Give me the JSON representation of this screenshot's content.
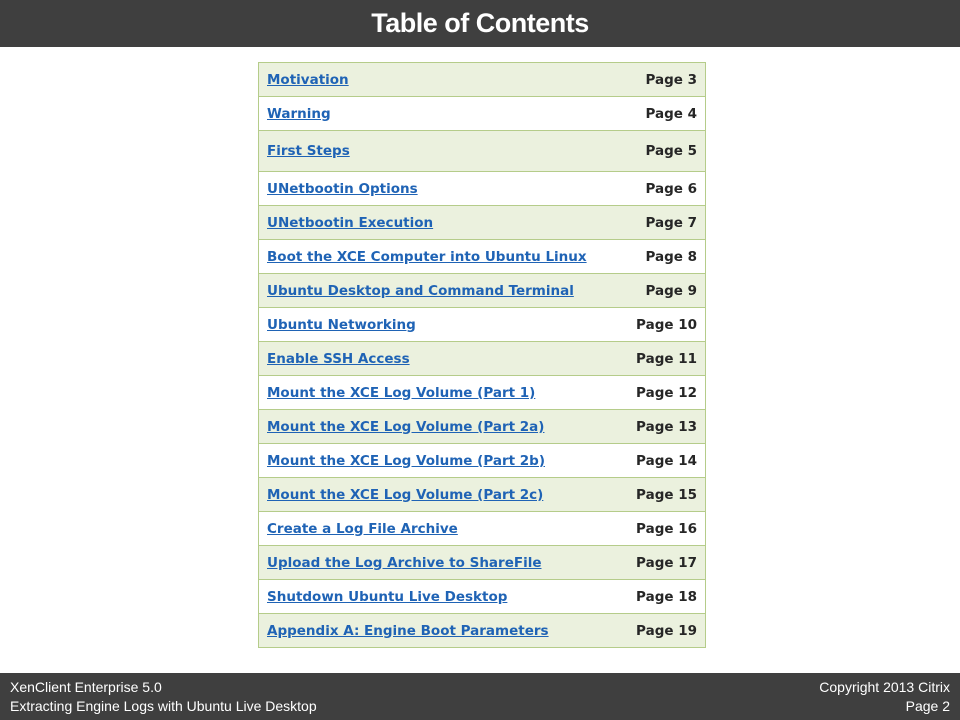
{
  "header": {
    "title": "Table of Contents"
  },
  "toc": [
    {
      "label": "Motivation",
      "page": "Page 3"
    },
    {
      "label": "Warning",
      "page": "Page 4"
    },
    {
      "label": "First Steps",
      "page": "Page 5"
    },
    {
      "label": "UNetbootin Options",
      "page": "Page 6"
    },
    {
      "label": "UNetbootin Execution",
      "page": "Page 7"
    },
    {
      "label": "Boot the XCE Computer into Ubuntu Linux",
      "page": "Page 8"
    },
    {
      "label": "Ubuntu Desktop and Command Terminal",
      "page": "Page 9"
    },
    {
      "label": "Ubuntu Networking",
      "page": "Page 10"
    },
    {
      "label": "Enable SSH Access",
      "page": "Page 11"
    },
    {
      "label": "Mount the XCE Log Volume (Part 1)",
      "page": "Page 12"
    },
    {
      "label": "Mount the XCE Log Volume (Part 2a)",
      "page": "Page 13"
    },
    {
      "label": "Mount the XCE Log Volume (Part 2b)",
      "page": "Page 14"
    },
    {
      "label": "Mount the XCE Log Volume (Part 2c)",
      "page": "Page 15"
    },
    {
      "label": "Create a Log File Archive",
      "page": "Page 16"
    },
    {
      "label": "Upload the Log Archive to ShareFile",
      "page": "Page 17"
    },
    {
      "label": "Shutdown Ubuntu Live Desktop",
      "page": "Page 18"
    },
    {
      "label": "Appendix A:  Engine Boot Parameters",
      "page": "Page 19"
    }
  ],
  "footer": {
    "product": "XenClient Enterprise 5.0",
    "doc_title": "Extracting Engine Logs with Ubuntu Live Desktop",
    "copyright": "Copyright 2013 Citrix",
    "page": "Page 2"
  },
  "colors": {
    "bar_background": "#3f3f3f",
    "row_shade": "#ebf1de",
    "table_border": "#b5cc8a",
    "link": "#1f63b5"
  }
}
